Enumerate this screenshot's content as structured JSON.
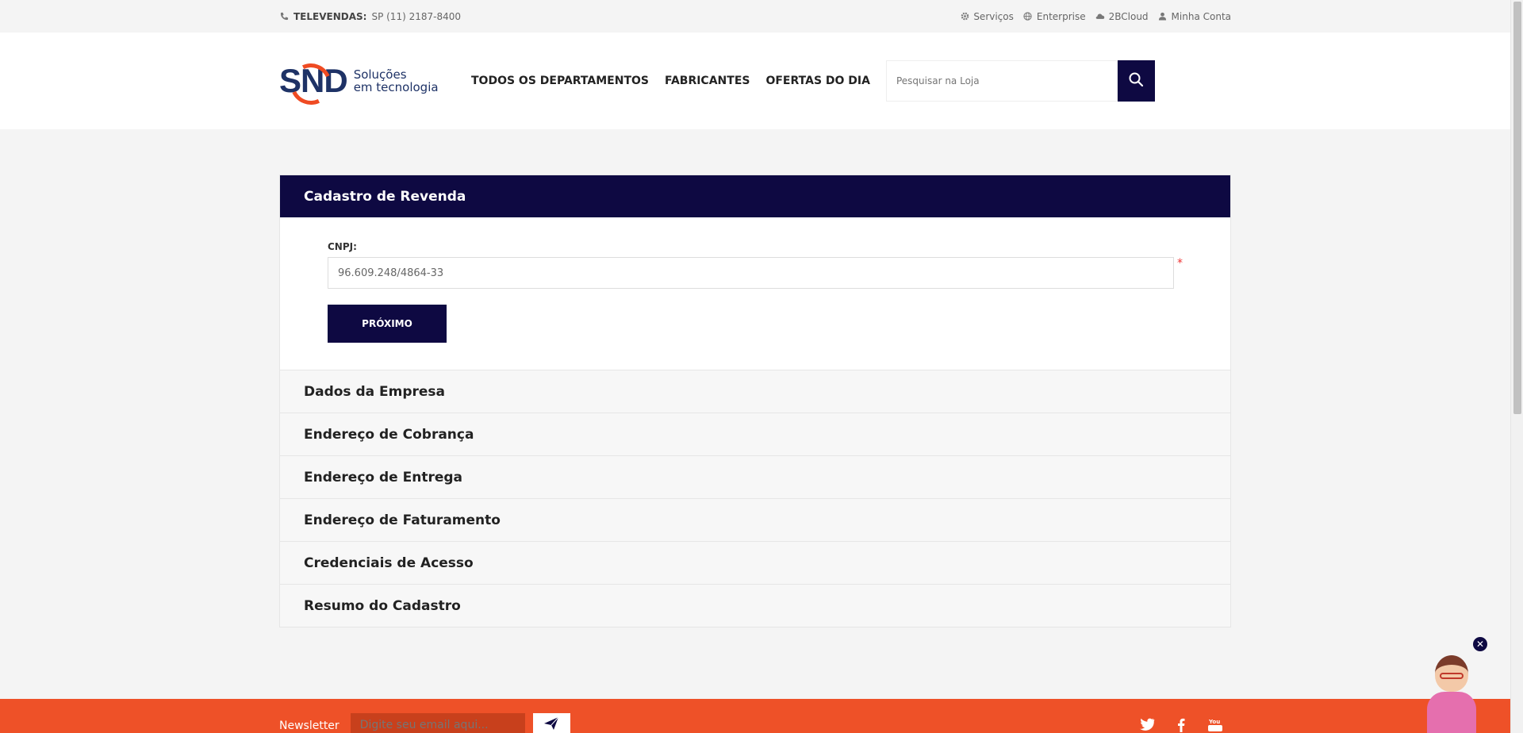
{
  "topbar": {
    "tel_label": "TELEVENDAS:",
    "tel_number": "SP (11)  2187-8400",
    "links": [
      {
        "label": "Serviços",
        "icon": "gear-icon"
      },
      {
        "label": "Enterprise",
        "icon": "globe-icon"
      },
      {
        "label": "2BCloud",
        "icon": "cloud-icon"
      },
      {
        "label": "Minha Conta",
        "icon": "user-icon"
      }
    ]
  },
  "header": {
    "logo_text": "SND",
    "logo_sub_1": "Soluções",
    "logo_sub_2": "em tecnologia",
    "nav": [
      "TODOS OS DEPARTAMENTOS",
      "FABRICANTES",
      "OFERTAS DO DIA"
    ],
    "search_placeholder": "Pesquisar na Loja"
  },
  "form": {
    "title": "Cadastro de Revenda",
    "cnpj_label": "CNPJ:",
    "cnpj_value": "96.609.248/4864-33",
    "required_mark": "*",
    "next_label": "PRÓXIMO",
    "steps": [
      "Dados da Empresa",
      "Endereço de Cobrança",
      "Endereço de Entrega",
      "Endereço de Faturamento",
      "Credenciais de Acesso",
      "Resumo do Cadastro"
    ]
  },
  "footer": {
    "newsletter_label": "Newsletter",
    "newsletter_placeholder": "Digite seu email aqui...",
    "social": [
      "twitter-icon",
      "facebook-icon",
      "youtube-icon"
    ]
  },
  "colors": {
    "navy": "#0e0942",
    "orange": "#ee5128",
    "logo_blue": "#1e3266"
  }
}
